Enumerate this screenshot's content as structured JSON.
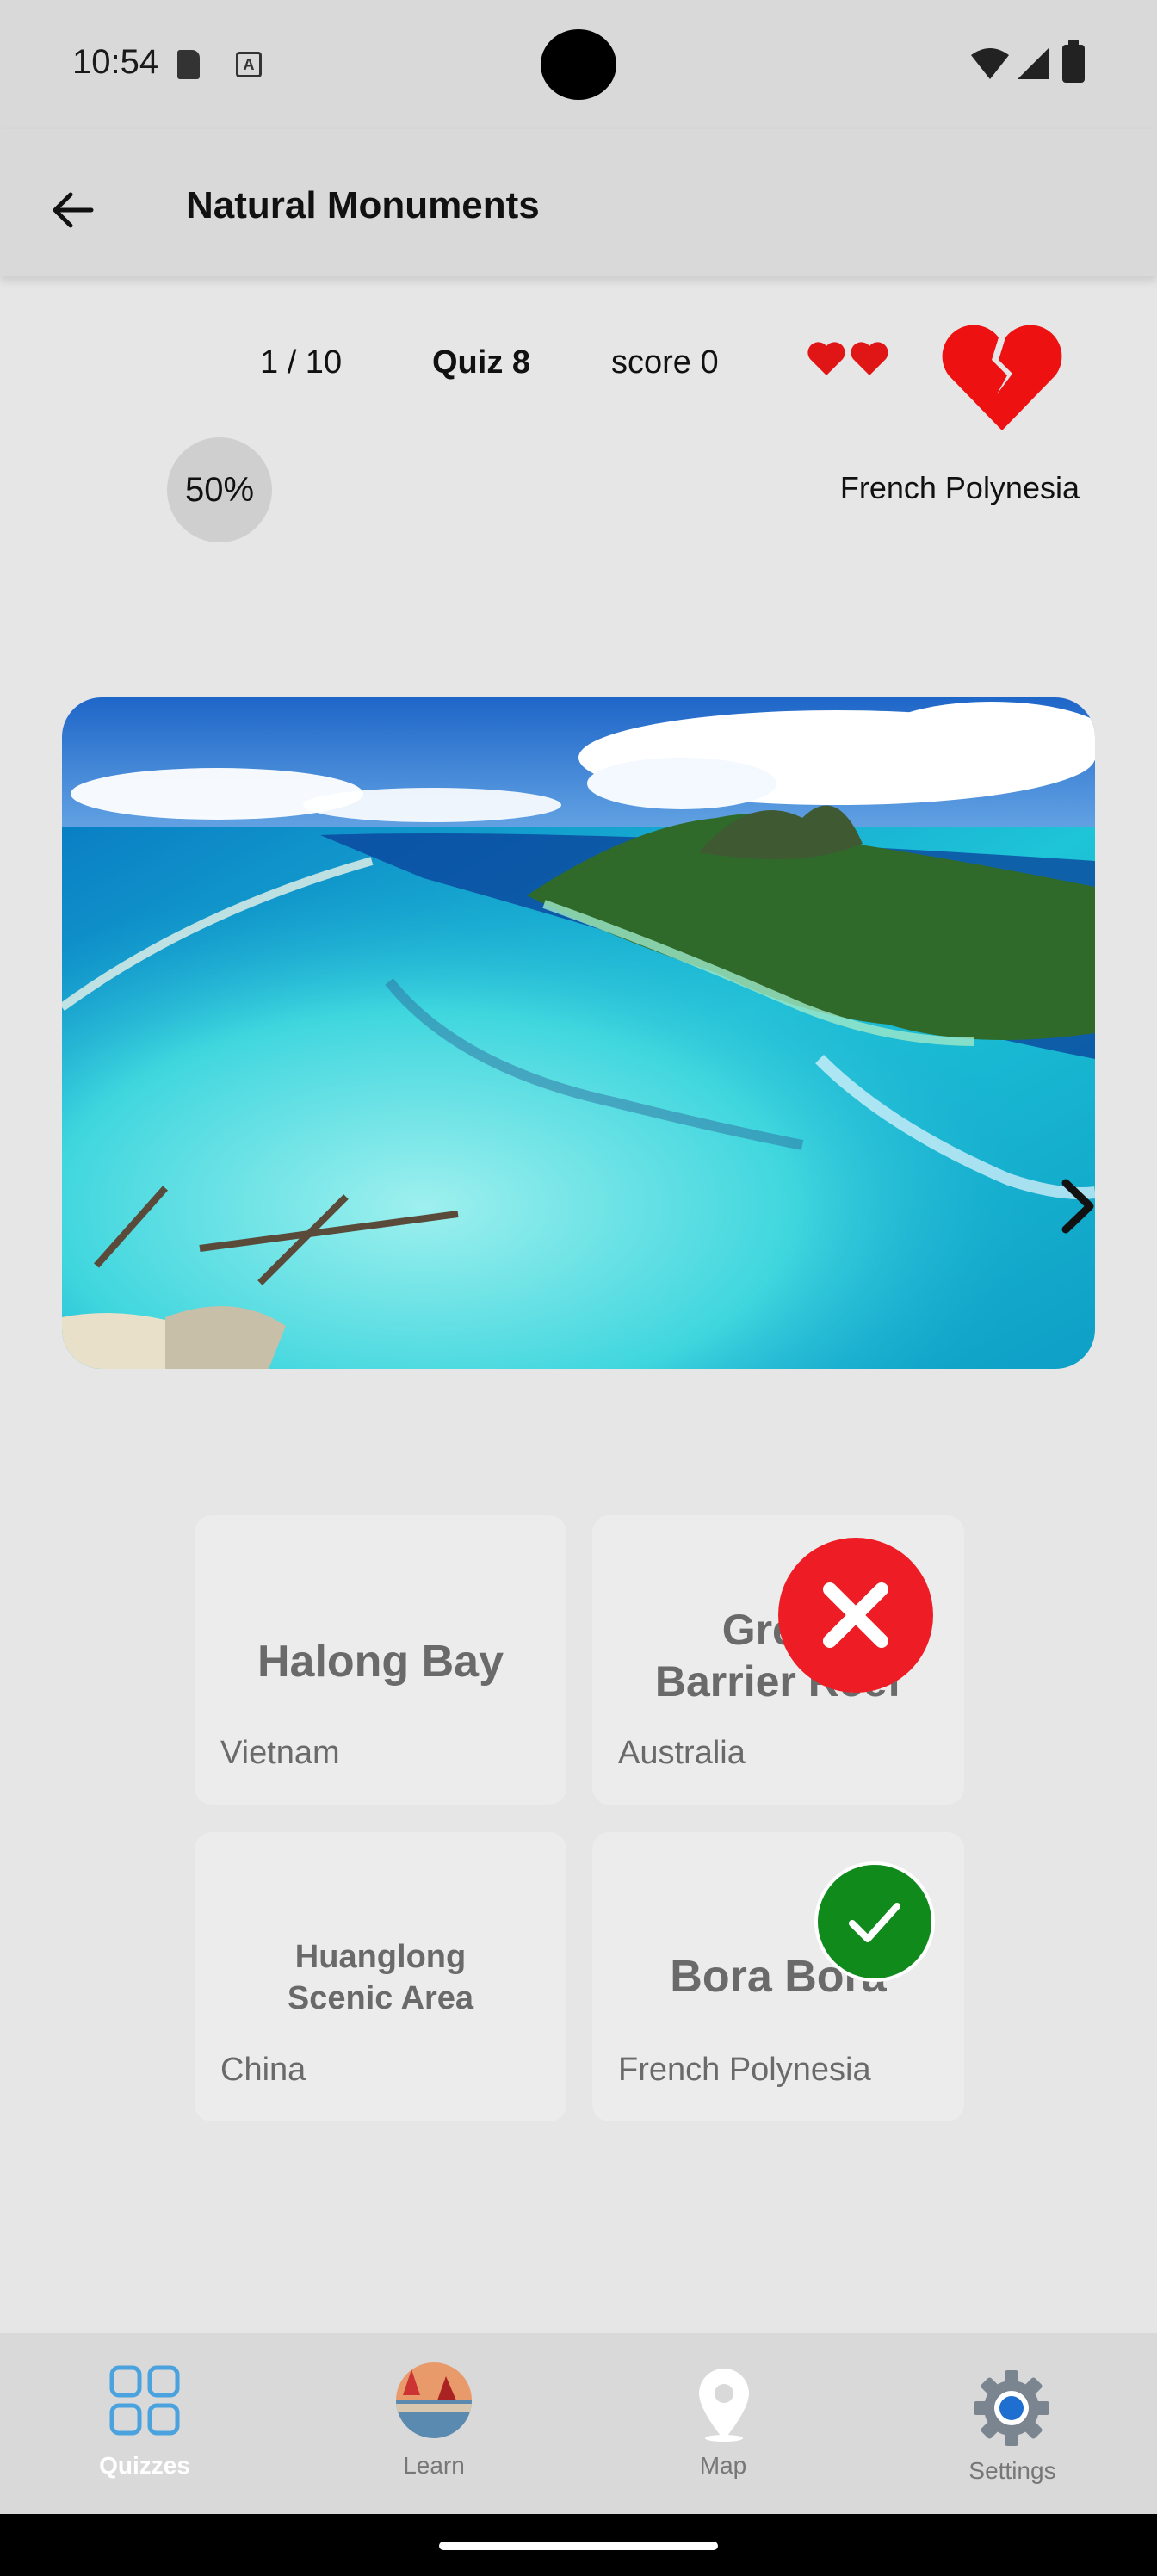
{
  "status_bar": {
    "time": "10:54",
    "font_icon_letter": "A"
  },
  "app_bar": {
    "title": "Natural Monuments",
    "back_icon": "arrow-left-icon"
  },
  "quiz": {
    "progress": "1 / 10",
    "name": "Quiz 8",
    "score": "score 0",
    "lives_display": "❤️❤️",
    "percent": "50%",
    "country_hint": "French Polynesia"
  },
  "photo": {
    "subject": "Bora Bora aerial view"
  },
  "answers": [
    {
      "name_line1": "Halong Bay",
      "name_line2": "",
      "country": "Vietnam",
      "state": "none"
    },
    {
      "name_line1": "Great",
      "name_line2": "Barrier Reef",
      "country": "Australia",
      "state": "wrong"
    },
    {
      "name_line1": "Huanglong",
      "name_line2": "Scenic Area",
      "country": "China",
      "state": "none"
    },
    {
      "name_line1": "Bora Bora",
      "name_line2": "",
      "country": "French Polynesia",
      "state": "correct"
    }
  ],
  "nav": {
    "items": [
      {
        "label": "Quizzes",
        "icon": "grid-icon",
        "active": true
      },
      {
        "label": "Learn",
        "icon": "learn-avatar-icon",
        "active": false
      },
      {
        "label": "Map",
        "icon": "map-pin-icon",
        "active": false
      },
      {
        "label": "Settings",
        "icon": "gear-icon",
        "active": false
      }
    ]
  },
  "colors": {
    "active_tab": "#4aa3df",
    "wrong": "#ee1c24",
    "correct": "#0f8a1b",
    "heart": "#ee1111"
  }
}
